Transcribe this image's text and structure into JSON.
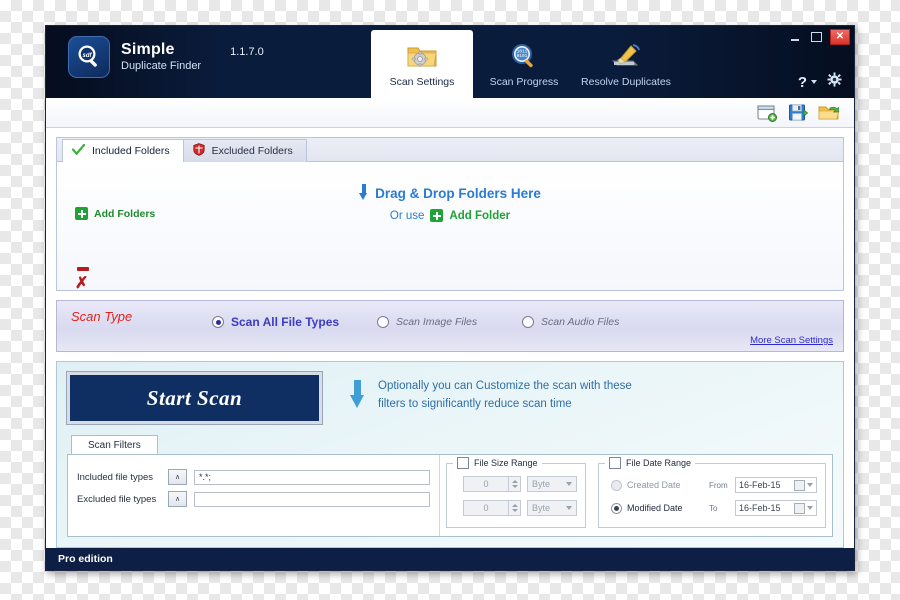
{
  "window": {
    "controls": {
      "minimize": "–",
      "maximize": "□",
      "close": "✕"
    }
  },
  "header": {
    "brand_line1": "Simple",
    "brand_line2": "Duplicate Finder",
    "version": "1.1.7.0",
    "logo_icon": "magnifier-logo-icon",
    "help_label": "?",
    "gear_icon": "gear-icon",
    "tabs": [
      {
        "label": "Scan Settings",
        "icon": "folder-gear-icon",
        "active": true
      },
      {
        "label": "Scan Progress",
        "icon": "binary-magnifier-icon",
        "active": false
      },
      {
        "label": "Resolve Duplicates",
        "icon": "broom-disk-icon",
        "active": false
      }
    ]
  },
  "toolbar": {
    "icons": [
      {
        "name": "new-project-icon"
      },
      {
        "name": "save-project-icon"
      },
      {
        "name": "open-project-icon"
      }
    ]
  },
  "folders": {
    "tabs": [
      {
        "label": "Included Folders",
        "icon": "green-check-icon",
        "active": true
      },
      {
        "label": "Excluded Folders",
        "icon": "red-shield-icon",
        "active": false
      }
    ],
    "add_folders_label": "Add Folders",
    "drop_title": "Drag & Drop Folders Here",
    "drop_or_use": "Or use",
    "drop_add_folder": "Add Folder",
    "remove_icon": "minus-icon",
    "clear_icon": "x-icon"
  },
  "scan_type": {
    "title": "Scan Type",
    "options": [
      {
        "label": "Scan All File Types",
        "selected": true
      },
      {
        "label": "Scan Image Files",
        "selected": false
      },
      {
        "label": "Scan Audio Files",
        "selected": false
      }
    ],
    "more_link": "More Scan Settings"
  },
  "scan": {
    "start_button": "Start Scan",
    "note_line1": "Optionally you can Customize the scan with these",
    "note_line2": "filters to significantly reduce scan time"
  },
  "filters": {
    "tab_label": "Scan Filters",
    "included_label": "Included file types",
    "included_value": "*.*;",
    "excluded_label": "Excluded file types",
    "excluded_value": "",
    "expand_glyph": "∧",
    "size_range": {
      "title": "File Size Range",
      "checked": false,
      "min_value": "0",
      "max_value": "0",
      "min_unit": "Byte",
      "max_unit": "Byte"
    },
    "date_range": {
      "title": "File Date Range",
      "checked": false,
      "created_label": "Created Date",
      "created_selected": false,
      "modified_label": "Modified Date",
      "modified_selected": true,
      "from_label": "From",
      "to_label": "To",
      "from_value": "16-Feb-15",
      "to_value": "16-Feb-15"
    }
  },
  "statusbar": {
    "edition": "Pro edition"
  },
  "colors": {
    "brand_navy": "#0f2f63",
    "accent_blue": "#2a7bd4",
    "green": "#1fa336",
    "red": "#b71c1c",
    "scan_type_red": "#e2231a",
    "link_blue": "#2a2ad0"
  }
}
